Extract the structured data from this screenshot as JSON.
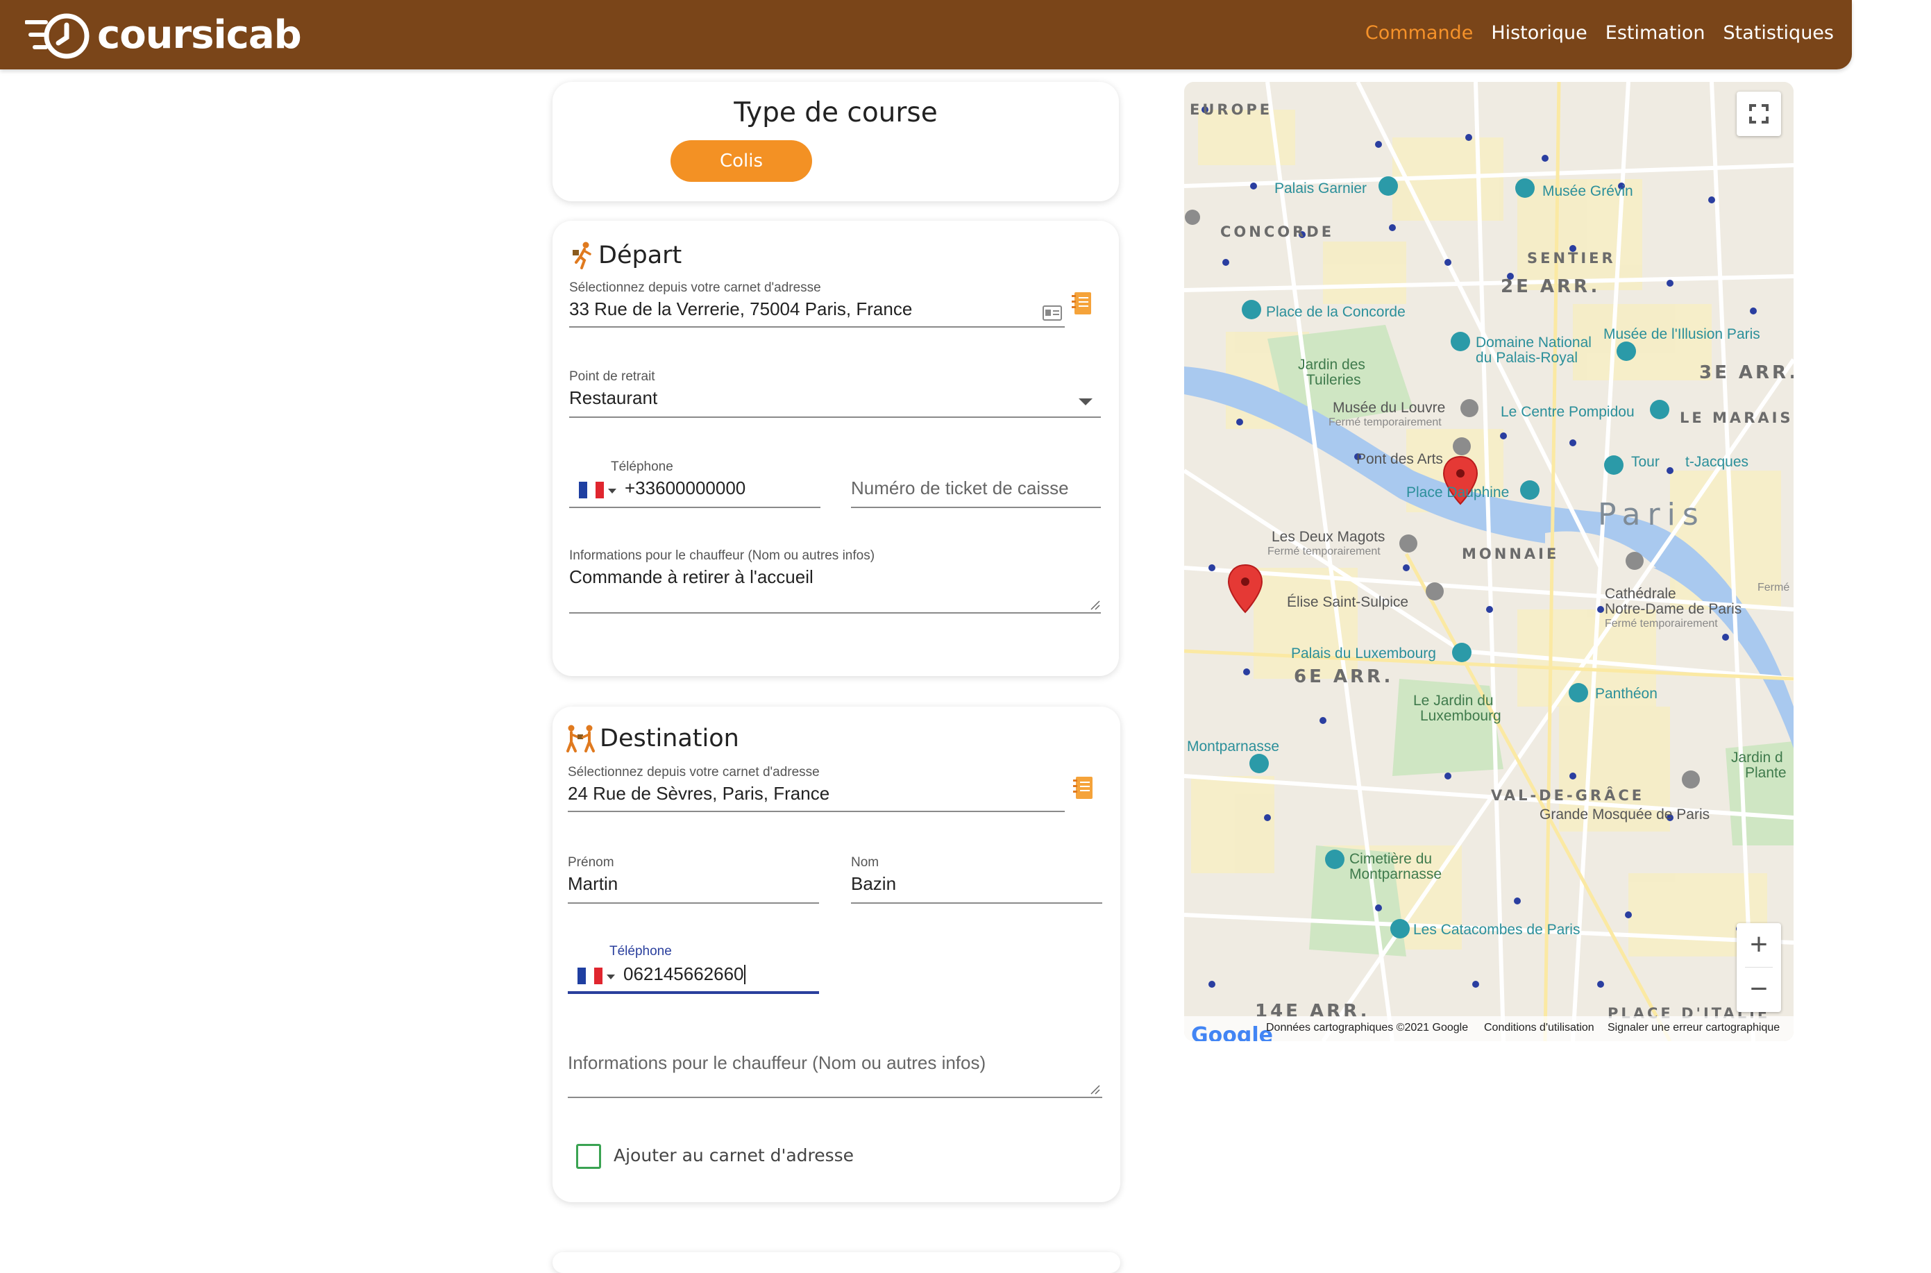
{
  "app": {
    "name": "coursicab"
  },
  "nav": [
    {
      "label": "Commande",
      "active": true
    },
    {
      "label": "Historique",
      "active": false
    },
    {
      "label": "Estimation",
      "active": false
    },
    {
      "label": "Statistiques",
      "active": false
    }
  ],
  "type_course": {
    "title": "Type de course",
    "button": "Colis"
  },
  "depart": {
    "title": "Départ",
    "address_label": "Sélectionnez depuis votre carnet d'adresse",
    "address_value": "33 Rue de la Verrerie, 75004 Paris, France",
    "pickup_label": "Point de retrait",
    "pickup_value": "Restaurant",
    "phone_label": "Téléphone",
    "phone_value": "+33600000000",
    "ticket_placeholder": "Numéro de ticket de caisse",
    "info_label": "Informations pour le chauffeur (Nom ou autres infos)",
    "info_value": "Commande à retirer à l'accueil"
  },
  "destination": {
    "title": "Destination",
    "address_label": "Sélectionnez depuis votre carnet d'adresse",
    "address_value": "24 Rue de Sèvres, Paris, France",
    "firstname_label": "Prénom",
    "firstname_value": "Martin",
    "lastname_label": "Nom",
    "lastname_value": "Bazin",
    "phone_label": "Téléphone",
    "phone_value": "062145662660",
    "info_placeholder": "Informations pour le chauffeur (Nom ou autres infos)",
    "save_label": "Ajouter au carnet d'adresse"
  },
  "map": {
    "labels": {
      "europe": "EUROPE",
      "concorde": "CONCORDE",
      "sentier": "SENTIER",
      "arr2": "2E ARR.",
      "arr3": "3E ARR.",
      "marais": "LE MARAIS",
      "monnaie": "MONNAIE",
      "arr6": "6E ARR.",
      "valdegrace": "VAL-DE-GRÂCE",
      "arr14": "14E ARR.",
      "placeitalie": "PLACE D'ITALIE",
      "paris": "Paris",
      "palais_garnier": "Palais Garnier",
      "musee_grevin": "Musée Grévin",
      "place_concorde": "Place de la Concorde",
      "domaine_national": "Domaine National",
      "du_palais_royal": "du Palais-Royal",
      "musee_illusion": "Musée de l'Illusion Paris",
      "jardin_tuileries_1": "Jardin des",
      "jardin_tuileries_2": "Tuileries",
      "musee_louvre": "Musée du Louvre",
      "louvre_ferme": "Fermé temporairement",
      "centre_pompidou": "Le Centre Pompidou",
      "pont_arts": "Pont des Arts",
      "tour_1": "Tour",
      "tour_2": "t-Jacques",
      "place_dauphine": "Place Dauphine",
      "deux_magots": "Les Deux Magots",
      "magots_ferme": "Fermé temporairement",
      "saint_sulpice_1": "É",
      "saint_sulpice_2": "lise Saint-Sulpice",
      "notre_dame_1": "Cathédrale",
      "notre_dame_2": "Notre-Dame de Paris",
      "notre_dame_ferme": "Fermé temporairement",
      "palais_luxembourg": "Palais du Luxembourg",
      "pantheon": "Panthéon",
      "jardin_lux_1": "Le Jardin du",
      "jardin_lux_2": "Luxembourg",
      "montparnasse": "Montparnasse",
      "jardin_plantes_1": "Jardin d",
      "jardin_plantes_2": "Plante",
      "grande_mosquee": "Grande Mosquée de Paris",
      "cimetiere_1": "Cimetière du",
      "cimetiere_2": "Montparnasse",
      "catacombes": "Les Catacombes de Paris",
      "ferme": "Fermé"
    },
    "footer": {
      "brand": "Google",
      "data": "Données cartographiques ©2021 Google",
      "terms": "Conditions d'utilisation",
      "report": "Signaler une erreur cartographique"
    },
    "zoom_in": "+",
    "zoom_out": "−"
  },
  "colors": {
    "brand": "#7a4519",
    "accent": "#f39124",
    "focus": "#2a3f9d",
    "checkbox": "#3aa352"
  },
  "icons": [
    "logo-clock-icon",
    "address-book-icon",
    "id-card-icon",
    "dropdown-arrow-icon",
    "france-flag-icon",
    "runner-icon",
    "handoff-icon",
    "map-pin-icon",
    "fullscreen-icon"
  ]
}
